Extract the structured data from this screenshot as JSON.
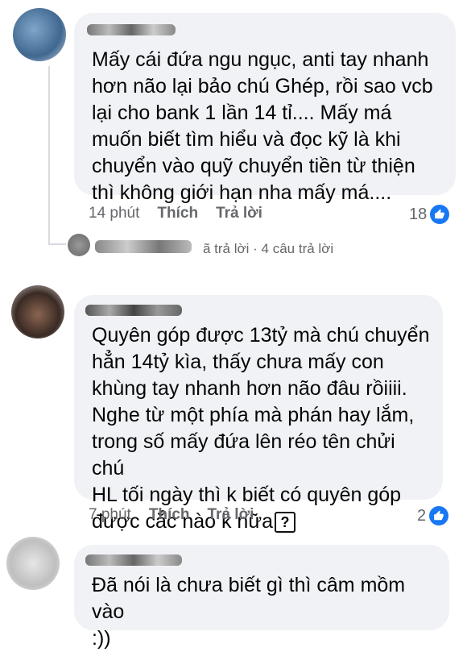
{
  "comments": [
    {
      "text": "Mấy cái đứa ngu ngục, anti tay nhanh\nhơn não lại bảo chú Ghép, rồi sao vcb\nlại cho bank 1 lần 14 tỉ.... Mấy má\nmuốn biết tìm hiểu và đọc kỹ là khi\nchuyển vào quỹ chuyển tiền từ thiện\nthì không giới hạn nha mấy má....",
      "time": "14 phút",
      "like_label": "Thích",
      "reply_label": "Trả lời",
      "reaction_count": "18"
    },
    {
      "text": "Quyên góp được 13tỷ mà chú chuyển\nhẳn 14tỷ kìa, thấy chưa mấy con\nkhùng tay nhanh hơn não đâu rồiiii.\nNghe từ một phía mà phán hay lắm,\ntrong số mấy đứa lên réo tên chửi chú\nHL tối ngày thì k biết có quyên góp\nđược cắc nào k nữa",
      "emoji_box": "?",
      "time": "7 phút",
      "like_label": "Thích",
      "reply_label": "Trả lời",
      "reaction_count": "2"
    },
    {
      "text": "Đã nói là chưa biết gì thì câm mồm vào\n:))"
    }
  ],
  "replies_summary": "ã trả lời · 4 câu trả lời",
  "colors": {
    "like_blue": "#1877f2",
    "bubble_bg": "#f0f2f5",
    "meta_gray": "#65676b"
  }
}
